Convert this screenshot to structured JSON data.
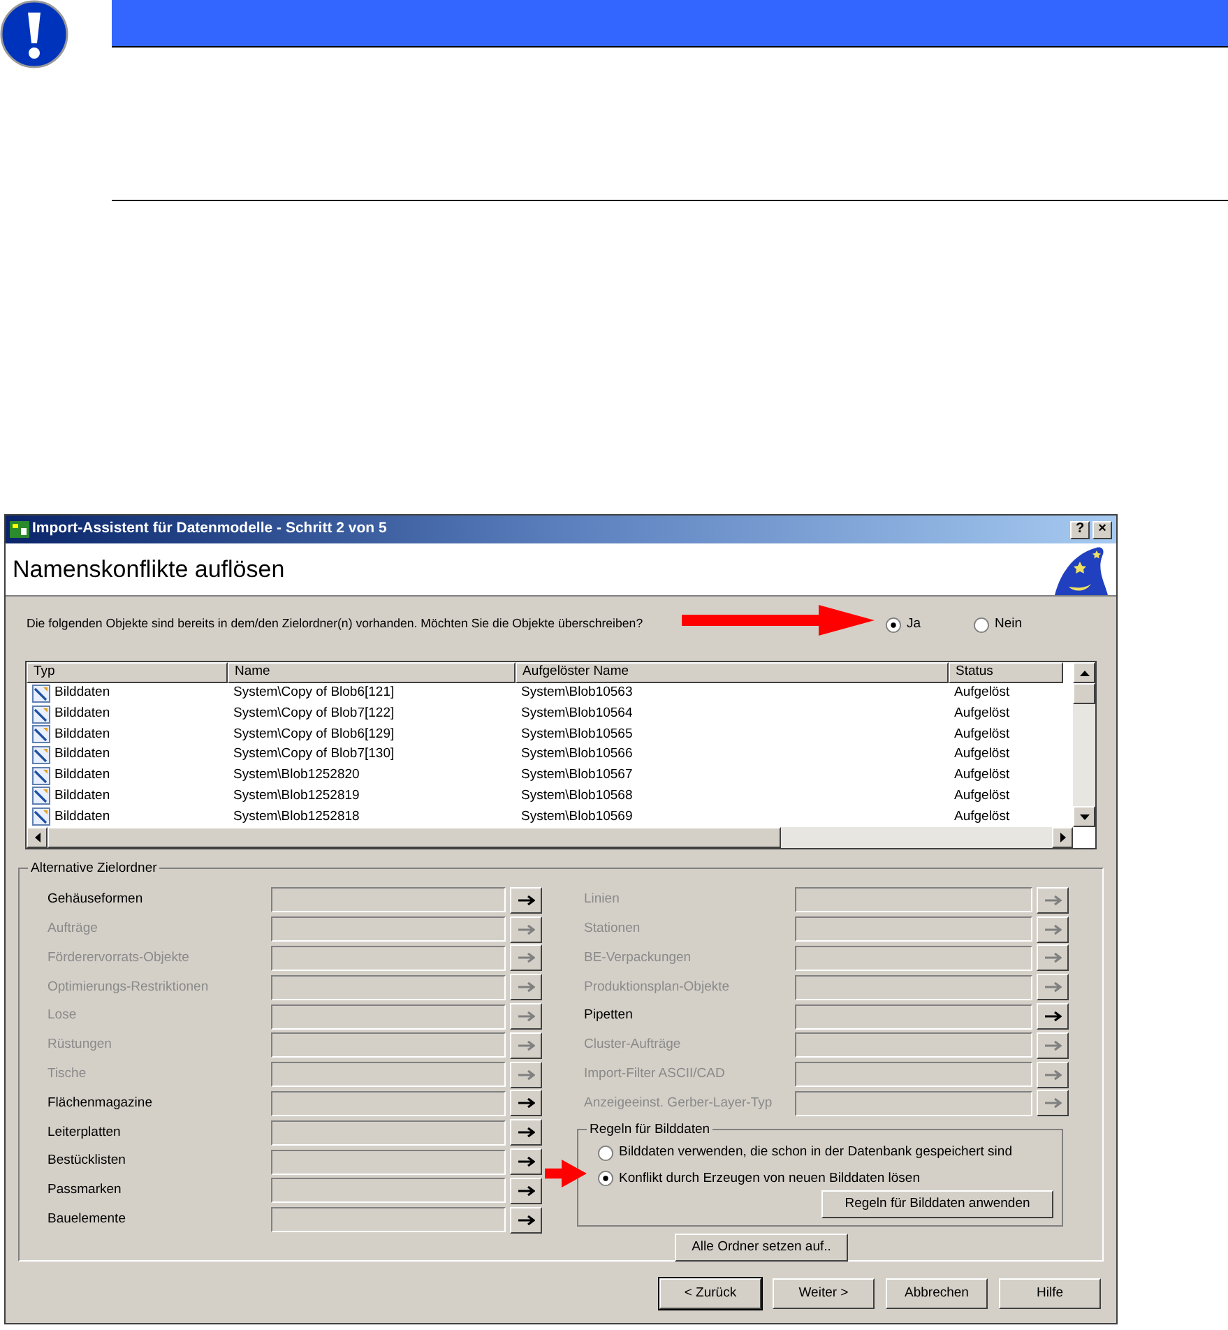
{
  "window": {
    "title": "Import-Assistent für Datenmodelle - Schritt 2 von 5",
    "buttons": [
      "?",
      "×"
    ]
  },
  "header": {
    "title": "Namenskonflikte auflösen"
  },
  "question": {
    "text": "Die folgenden Objekte sind bereits in dem/den Zielordner(n) vorhanden. Möchten Sie die Objekte überschreiben?",
    "options": [
      {
        "label": "Ja",
        "selected": true
      },
      {
        "label": "Nein",
        "selected": false
      }
    ]
  },
  "table": {
    "columns": [
      "Typ",
      "Name",
      "Aufgelöster Name",
      "Status"
    ],
    "rows": [
      [
        "Bilddaten",
        "System\\Copy of Blob6[121]",
        "System\\Blob10563",
        "Aufgelöst"
      ],
      [
        "Bilddaten",
        "System\\Copy of Blob7[122]",
        "System\\Blob10564",
        "Aufgelöst"
      ],
      [
        "Bilddaten",
        "System\\Copy of Blob6[129]",
        "System\\Blob10565",
        "Aufgelöst"
      ],
      [
        "Bilddaten",
        "System\\Copy of Blob7[130]",
        "System\\Blob10566",
        "Aufgelöst"
      ],
      [
        "Bilddaten",
        "System\\Blob1252820",
        "System\\Blob10567",
        "Aufgelöst"
      ],
      [
        "Bilddaten",
        "System\\Blob1252819",
        "System\\Blob10568",
        "Aufgelöst"
      ],
      [
        "Bilddaten",
        "System\\Blob1252818",
        "System\\Blob10569",
        "Aufgelöst"
      ]
    ]
  },
  "alternative_folders": {
    "title": "Alternative Zielordner",
    "left": [
      {
        "label": "Gehäuseformen",
        "disabled": false
      },
      {
        "label": "Aufträge",
        "disabled": true
      },
      {
        "label": "Förderervorrats-Objekte",
        "disabled": true
      },
      {
        "label": "Optimierungs-Restriktionen",
        "disabled": true
      },
      {
        "label": "Lose",
        "disabled": true
      },
      {
        "label": "Rüstungen",
        "disabled": true
      },
      {
        "label": "Tische",
        "disabled": true
      },
      {
        "label": "Flächenmagazine",
        "disabled": false
      },
      {
        "label": "Leiterplatten",
        "disabled": false
      },
      {
        "label": "Bestücklisten",
        "disabled": false
      },
      {
        "label": "Passmarken",
        "disabled": false
      },
      {
        "label": "Bauelemente",
        "disabled": false
      }
    ],
    "right": [
      {
        "label": "Linien",
        "disabled": true
      },
      {
        "label": "Stationen",
        "disabled": true
      },
      {
        "label": "BE-Verpackungen",
        "disabled": true
      },
      {
        "label": "Produktionsplan-Objekte",
        "disabled": true
      },
      {
        "label": "Pipetten",
        "disabled": false
      },
      {
        "label": "Cluster-Aufträge",
        "disabled": true
      },
      {
        "label": "Import-Filter ASCII/CAD",
        "disabled": true
      },
      {
        "label": "Anzeigeeinst. Gerber-Layer-Typ",
        "disabled": true
      }
    ]
  },
  "image_rules": {
    "title": "Regeln für Bilddaten",
    "options": [
      {
        "label": "Bilddaten verwenden, die schon in der Datenbank gespeichert sind",
        "selected": false
      },
      {
        "label": "Konflikt durch Erzeugen von neuen Bilddaten lösen",
        "selected": true
      }
    ],
    "apply_button": "Regeln für Bilddaten anwenden"
  },
  "set_all_button": "Alle Ordner setzen auf..",
  "buttons": [
    {
      "label": "< Zurück",
      "default": true
    },
    {
      "label": "Weiter >",
      "default": false
    },
    {
      "label": "Abbrechen",
      "default": false
    },
    {
      "label": "Hilfe",
      "default": false
    }
  ]
}
